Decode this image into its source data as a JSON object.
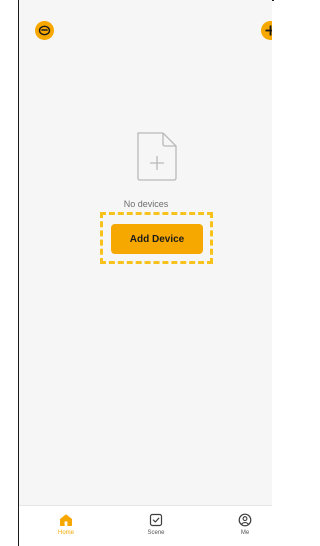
{
  "header": {
    "left_icon": "smiley-face-icon",
    "right_icon": "plus-icon"
  },
  "empty_state": {
    "icon": "empty-document-icon",
    "message": "No devices"
  },
  "action": {
    "add_device_label": "Add Device"
  },
  "tabbar": {
    "tabs": [
      {
        "label": "Home",
        "icon": "home-icon",
        "active": true
      },
      {
        "label": "Scene",
        "icon": "checkbox-icon",
        "active": false
      },
      {
        "label": "Me",
        "icon": "profile-icon",
        "active": false
      }
    ]
  },
  "colors": {
    "accent": "#f7a800",
    "highlight_dash": "#f7c21b",
    "background": "#f6f6f6"
  }
}
